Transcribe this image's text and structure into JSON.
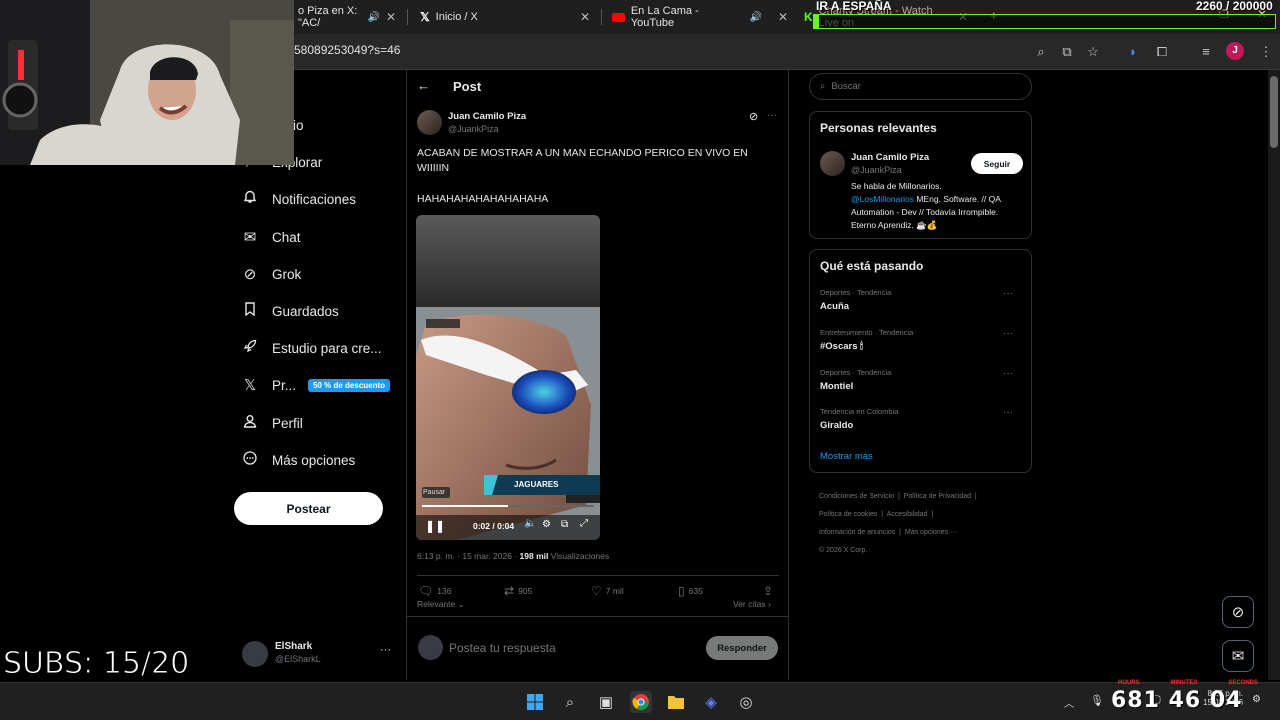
{
  "browser": {
    "tabs": [
      {
        "title": "o Piza en X: \"AC/",
        "active": true,
        "has_audio": true
      },
      {
        "title": "Inicio / X",
        "active": false,
        "has_audio": false
      },
      {
        "title": "En La Cama - YouTube",
        "active": false,
        "has_audio": true
      },
      {
        "title": "Charity Stream - Watch Live on",
        "active": false,
        "has_audio": false
      }
    ],
    "url": "58089253049?s=46",
    "profile_initial": "J"
  },
  "nav": {
    "items": [
      {
        "label": "Inicio",
        "icon": "home-icon",
        "glyph": "⌂"
      },
      {
        "label": "Explorar",
        "icon": "search-icon",
        "glyph": "⌕"
      },
      {
        "label": "Notificaciones",
        "icon": "bell-icon",
        "glyph": "🔔"
      },
      {
        "label": "Chat",
        "icon": "mail-icon",
        "glyph": "✉"
      },
      {
        "label": "Grok",
        "icon": "grok-icon",
        "glyph": "⊘"
      },
      {
        "label": "Guardados",
        "icon": "bookmark-icon",
        "glyph": "▯"
      },
      {
        "label": "Estudio para cre...",
        "icon": "rocket-icon",
        "glyph": "🚀"
      },
      {
        "label": "Pr...",
        "icon": "x-logo-icon",
        "glyph": "𝕏",
        "badge": "50 % de descuento"
      },
      {
        "label": "Perfil",
        "icon": "person-icon",
        "glyph": "👤"
      },
      {
        "label": "Más opciones",
        "icon": "more-circle-icon",
        "glyph": "⋯"
      }
    ],
    "post_button": "Postear",
    "account": {
      "name": "ElShark",
      "handle": "@ElSharkL"
    }
  },
  "post": {
    "header_title": "Post",
    "author_name": "Juan Camilo Piza",
    "author_handle": "@JuankPiza",
    "text_line1": "ACABAN DE MOSTRAR A UN MAN ECHANDO PERICO EN VIVO EN",
    "text_line2": "WIIIIIN",
    "text_line3": "HAHAHAHAHAHAHAHAHA",
    "video": {
      "pause_label": "Pausar",
      "time": "0:02 / 0:04",
      "overlay_team": "JAGUARES",
      "progress": 0.5
    },
    "meta_time": "6:13 p. m. · 15 mar. 2026 ·",
    "views_count": "198 mil",
    "views_label": "Visualizaciones",
    "stats": {
      "replies": "136",
      "reposts": "905",
      "likes": "7 mil",
      "bookmarks": "635"
    },
    "sort_label": "Relevante",
    "see_quotes": "Ver citas",
    "reply_placeholder": "Postea tu respuesta",
    "reply_button": "Responder"
  },
  "sidebar": {
    "search_placeholder": "Buscar",
    "relevant": {
      "title": "Personas relevantes",
      "name": "Juan Camilo Piza",
      "handle": "@JuankPiza",
      "follow": "Seguir",
      "bio_prefix": "Se habla de Millonarios.",
      "bio_mention": "@LosMillonarios",
      "bio_rest": "MEng. Software. // QA Automation - Dev // Todavía Irrompible. Eterno Aprendiz. ☕💰"
    },
    "trending": {
      "title": "Qué está pasando",
      "items": [
        {
          "meta": "Deportes · Tendencia",
          "name": "Acuña"
        },
        {
          "meta": "Entretenimiento · Tendencia",
          "name": "#Oscars 🕯"
        },
        {
          "meta": "Deportes · Tendencia",
          "name": "Montiel"
        },
        {
          "meta": "Tendencia en Colombia",
          "name": "Giraldo"
        }
      ],
      "show_more": "Mostrar más"
    },
    "footer": [
      "Condiciones de Servicio",
      "Política de Privacidad",
      "Política de cookies",
      "Accesibilidad",
      "Información de anuncios",
      "Más opciones ···",
      "© 2026 X Corp."
    ]
  },
  "overlay": {
    "goal_title": "IR A ESPAÑA",
    "goal_count": "2260 / 200000",
    "goal_progress": 0.0113,
    "subs": "SUBS: 15/20",
    "timer_labels": [
      "HOURS",
      "MINUTES",
      "SECONDS"
    ],
    "timer": "681 46 04"
  },
  "taskbar": {
    "time": "8:26 p. m.",
    "date": "15/03/2026",
    "lang": "ESP LAA"
  },
  "colors": {
    "accent": "#1d9bf0",
    "goal_green": "#6ef02b",
    "timer_red": "#ff2b2b"
  }
}
